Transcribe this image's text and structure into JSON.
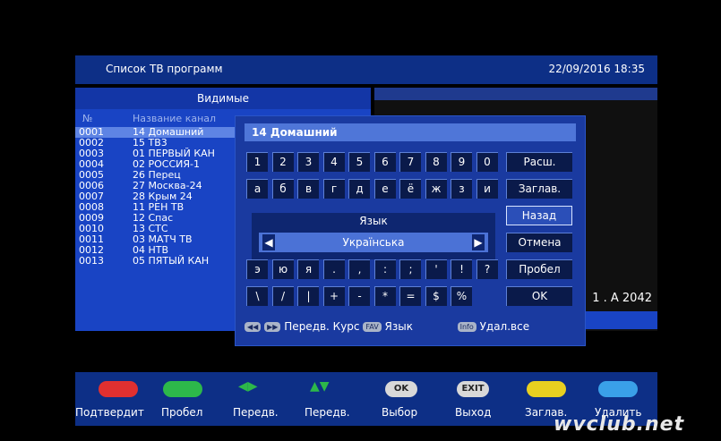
{
  "header": {
    "title": "Список ТВ программ",
    "datetime": "22/09/2016 18:35"
  },
  "list": {
    "tab": "Видимые",
    "col_no": "№",
    "col_name": "Название канал",
    "rows": [
      {
        "num": "0001",
        "name": "14 Домашний"
      },
      {
        "num": "0002",
        "name": "15 ТВ3"
      },
      {
        "num": "0003",
        "name": "01 ПЕРВЫЙ КАН"
      },
      {
        "num": "0004",
        "name": "02 РОССИЯ-1"
      },
      {
        "num": "0005",
        "name": "26 Перец"
      },
      {
        "num": "0006",
        "name": "27 Москва-24"
      },
      {
        "num": "0007",
        "name": "28 Крым 24"
      },
      {
        "num": "0008",
        "name": "11 РЕН ТВ"
      },
      {
        "num": "0009",
        "name": "12 Спас"
      },
      {
        "num": "0010",
        "name": "13 СТС"
      },
      {
        "num": "0011",
        "name": "03 МАТЧ ТВ"
      },
      {
        "num": "0012",
        "name": "04 НТВ"
      },
      {
        "num": "0013",
        "name": "05 ПЯТЫЙ КАН"
      }
    ]
  },
  "video": {
    "overlay_text": "1 . A 2042"
  },
  "keyboard": {
    "input_value": "14 Домашний",
    "row1": [
      "1",
      "2",
      "3",
      "4",
      "5",
      "6",
      "7",
      "8",
      "9",
      "0"
    ],
    "row2": [
      "а",
      "б",
      "в",
      "г",
      "д",
      "е",
      "ё",
      "ж",
      "з",
      "и"
    ],
    "row5": [
      "э",
      "ю",
      "я",
      ".",
      ",",
      ":",
      ";",
      "'",
      "!",
      "?"
    ],
    "row6": [
      "\\",
      "/",
      "|",
      "+",
      "-",
      "*",
      "=",
      "$",
      "%"
    ],
    "side": [
      "Расш.",
      "Заглав.",
      "Назад",
      "Отмена",
      "Пробел",
      "OK"
    ],
    "lang_title": "Язык",
    "lang_value": "Українська",
    "footer": {
      "move": "Передв. Курс",
      "fav_badge": "FAV",
      "lang": "Язык",
      "info_badge": "Info",
      "delete_all": "Удал.все"
    }
  },
  "bottom": {
    "labels": [
      "Подтвердит",
      "Пробел",
      "Передв.",
      "Передв.",
      "Выбор",
      "Выход",
      "Заглав.",
      "Удалить"
    ],
    "ok": "OK",
    "exit": "EXIT",
    "colors": {
      "red": "#e03030",
      "green": "#2db84a",
      "yellow": "#e8d020",
      "blue": "#3aa0e8"
    }
  },
  "watermark": "wvclub.net"
}
